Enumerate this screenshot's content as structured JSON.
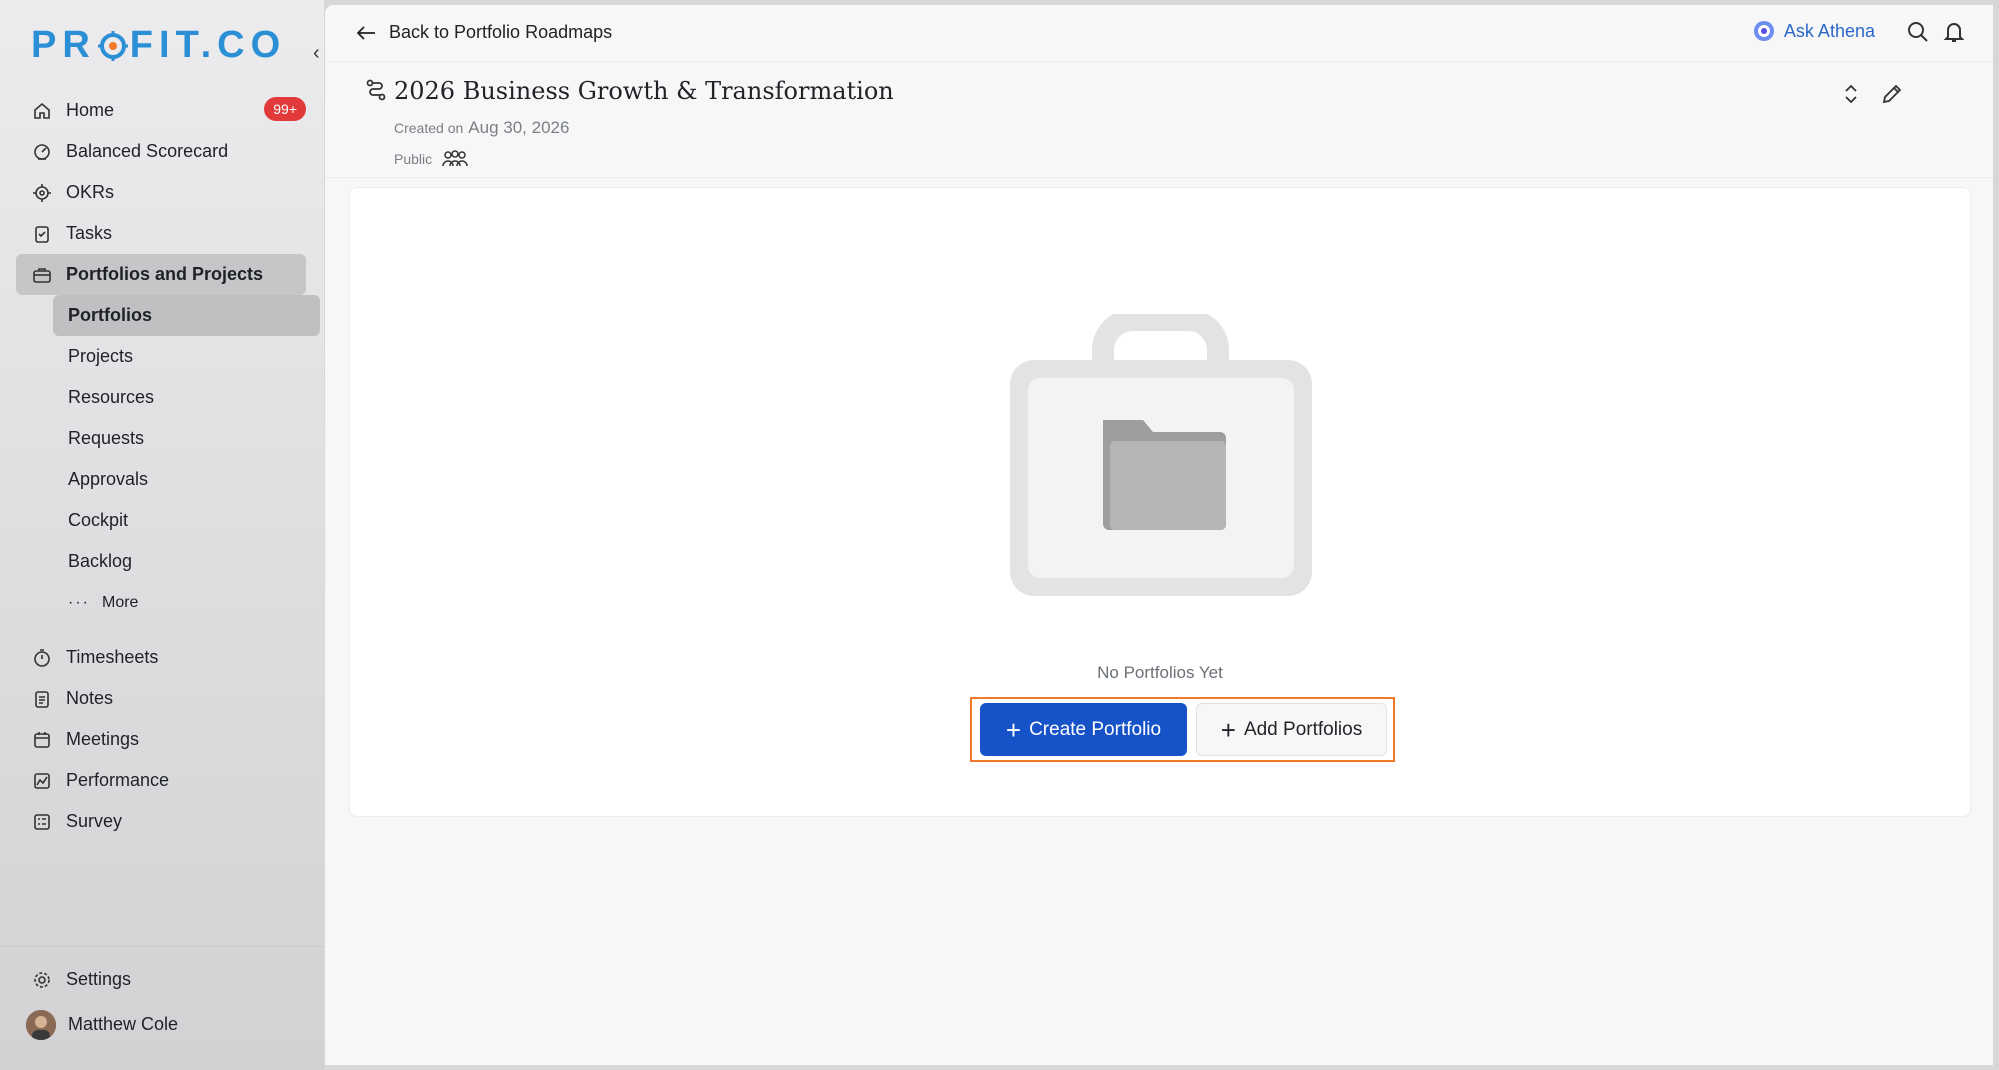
{
  "brand": {
    "logo_text": "PROFIT.CO",
    "accent": "#2b8fd6"
  },
  "sidebar": {
    "items": [
      {
        "label": "Home",
        "icon": "home-icon",
        "badge": "99+"
      },
      {
        "label": "Balanced Scorecard",
        "icon": "scorecard-icon"
      },
      {
        "label": "OKRs",
        "icon": "target-icon"
      },
      {
        "label": "Tasks",
        "icon": "clipboard-check-icon"
      },
      {
        "label": "Portfolios and Projects",
        "icon": "briefcase-icon",
        "active": true
      }
    ],
    "subitems": [
      "Portfolios",
      "Projects",
      "Resources",
      "Requests",
      "Approvals",
      "Cockpit",
      "Backlog"
    ],
    "more_label": "More",
    "items2": [
      {
        "label": "Timesheets",
        "icon": "stopwatch-icon"
      },
      {
        "label": "Notes",
        "icon": "notes-icon"
      },
      {
        "label": "Meetings",
        "icon": "calendar-icon"
      },
      {
        "label": "Performance",
        "icon": "chart-icon"
      },
      {
        "label": "Survey",
        "icon": "survey-icon"
      }
    ],
    "settings_label": "Settings",
    "user_name": "Matthew Cole"
  },
  "topbar": {
    "back_label": "Back to Portfolio Roadmaps",
    "athena_label": "Ask Athena"
  },
  "header": {
    "title": "2026 Business Growth & Transformation",
    "created_label": "Created on",
    "created_date": "Aug 30, 2026",
    "visibility": "Public"
  },
  "empty_state": {
    "message": "No Portfolios Yet",
    "create_button": "Create Portfolio",
    "add_button": "Add Portfolios"
  }
}
